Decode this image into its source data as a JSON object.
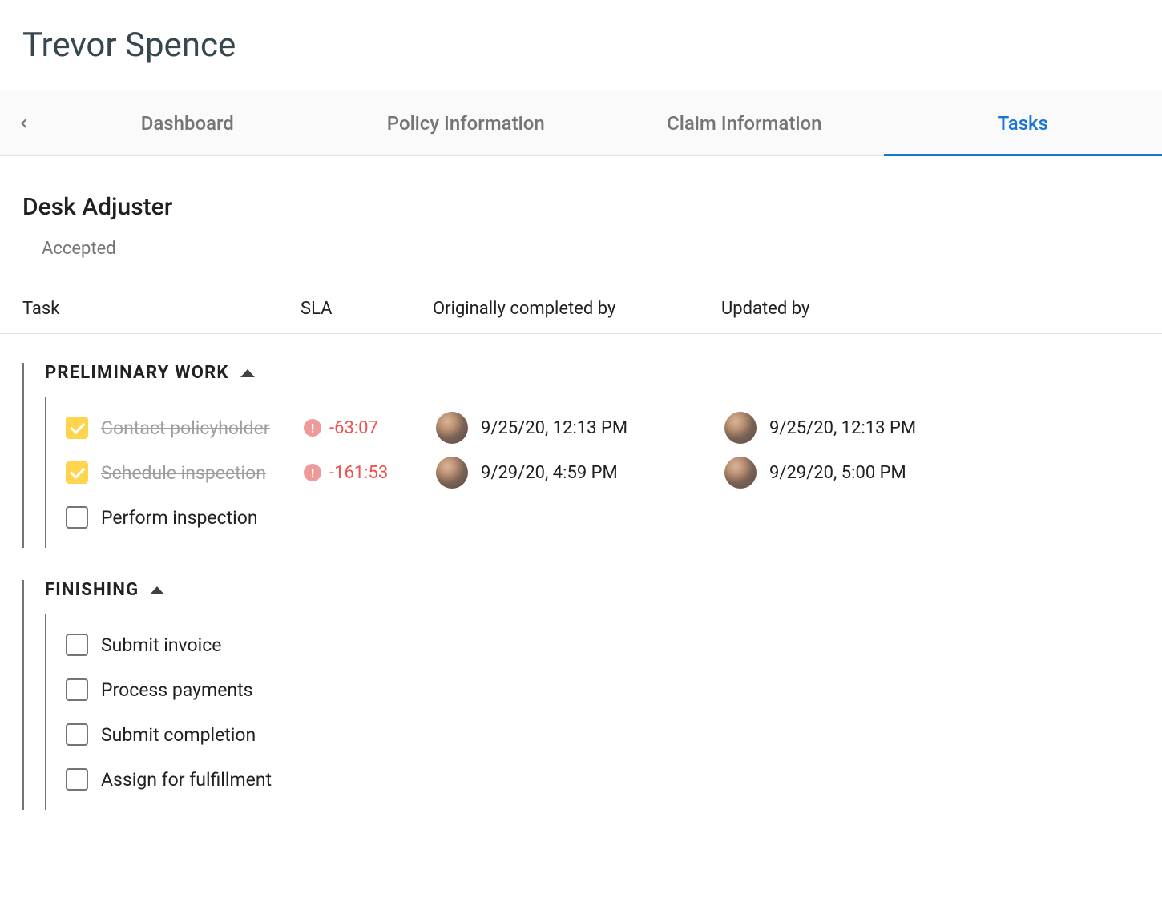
{
  "page_title": "Trevor Spence",
  "tabs": [
    {
      "label": "Dashboard",
      "active": false
    },
    {
      "label": "Policy Information",
      "active": false
    },
    {
      "label": "Claim Information",
      "active": false
    },
    {
      "label": "Tasks",
      "active": true
    }
  ],
  "role_title": "Desk Adjuster",
  "status": "Accepted",
  "columns": {
    "task": "Task",
    "sla": "SLA",
    "originally_completed_by": "Originally completed by",
    "updated_by": "Updated by"
  },
  "groups": [
    {
      "name": "PRELIMINARY WORK",
      "expanded": true,
      "tasks": [
        {
          "label": "Contact policyholder",
          "checked": true,
          "sla": "-63:07",
          "sla_alert": true,
          "originally_completed": "9/25/20, 12:13 PM",
          "updated": "9/25/20, 12:13 PM"
        },
        {
          "label": "Schedule inspection",
          "checked": true,
          "sla": "-161:53",
          "sla_alert": true,
          "originally_completed": "9/29/20, 4:59 PM",
          "updated": "9/29/20, 5:00 PM"
        },
        {
          "label": "Perform inspection",
          "checked": false,
          "sla": "",
          "sla_alert": false,
          "originally_completed": "",
          "updated": ""
        }
      ]
    },
    {
      "name": "FINISHING",
      "expanded": true,
      "tasks": [
        {
          "label": "Submit invoice",
          "checked": false,
          "sla": "",
          "sla_alert": false,
          "originally_completed": "",
          "updated": ""
        },
        {
          "label": "Process payments",
          "checked": false,
          "sla": "",
          "sla_alert": false,
          "originally_completed": "",
          "updated": ""
        },
        {
          "label": "Submit completion",
          "checked": false,
          "sla": "",
          "sla_alert": false,
          "originally_completed": "",
          "updated": ""
        },
        {
          "label": "Assign for fulfillment",
          "checked": false,
          "sla": "",
          "sla_alert": false,
          "originally_completed": "",
          "updated": ""
        }
      ]
    }
  ]
}
